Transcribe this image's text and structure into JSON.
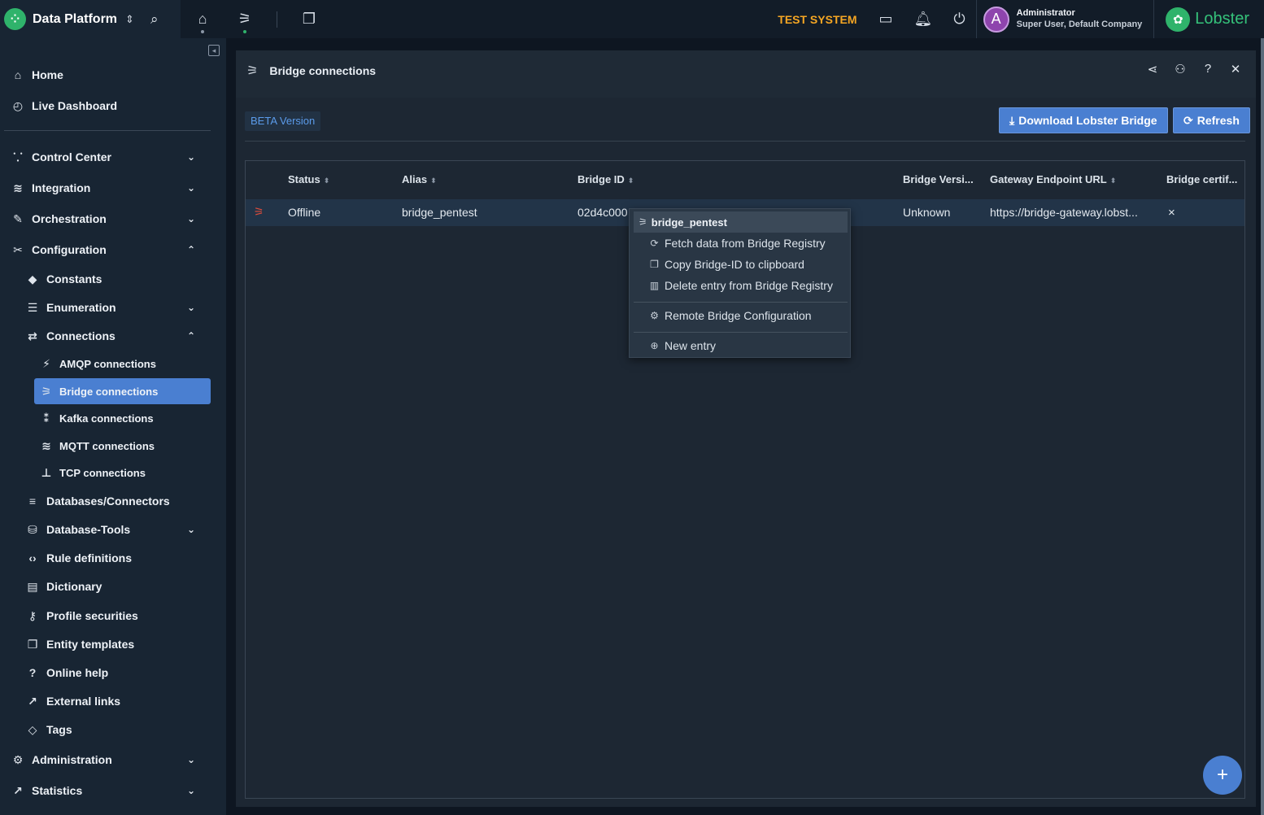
{
  "topbar": {
    "app_title": "Data Platform",
    "test_system": "TEST SYSTEM",
    "user_name": "Administrator",
    "user_role": "Super User, Default Company",
    "avatar_letter": "A",
    "brand_name": "Lobster",
    "icons": [
      "home-icon",
      "bridge-icon",
      "windows-icon",
      "monitor-icon",
      "bell-icon",
      "power-icon"
    ]
  },
  "sidebar": {
    "items": [
      {
        "label": "Home",
        "icon": "home-icon"
      },
      {
        "label": "Live Dashboard",
        "icon": "dashboard-icon"
      },
      {
        "label": "Control Center",
        "icon": "antenna-icon"
      },
      {
        "label": "Integration",
        "icon": "layers-icon"
      },
      {
        "label": "Orchestration",
        "icon": "wand-icon"
      },
      {
        "label": "Configuration",
        "icon": "tools-icon"
      },
      {
        "label": "Constants",
        "icon": "tag-icon"
      },
      {
        "label": "Enumeration",
        "icon": "database-icon"
      },
      {
        "label": "Connections",
        "icon": "arrows-icon"
      },
      {
        "label": "AMQP connections",
        "icon": "bolt-icon"
      },
      {
        "label": "Bridge connections",
        "icon": "bridge-icon"
      },
      {
        "label": "Kafka connections",
        "icon": "kafka-icon"
      },
      {
        "label": "MQTT connections",
        "icon": "rss-icon"
      },
      {
        "label": "TCP connections",
        "icon": "network-icon"
      },
      {
        "label": "Databases/Connectors",
        "icon": "database-icon"
      },
      {
        "label": "Database-Tools",
        "icon": "db-tools-icon"
      },
      {
        "label": "Rule definitions",
        "icon": "code-icon"
      },
      {
        "label": "Dictionary",
        "icon": "book-icon"
      },
      {
        "label": "Profile securities",
        "icon": "key-icon"
      },
      {
        "label": "Entity templates",
        "icon": "copy-icon"
      },
      {
        "label": "Online help",
        "icon": "help-icon"
      },
      {
        "label": "External links",
        "icon": "external-link-icon"
      },
      {
        "label": "Tags",
        "icon": "tags-icon"
      },
      {
        "label": "Administration",
        "icon": "gears-icon"
      },
      {
        "label": "Statistics",
        "icon": "chart-icon"
      }
    ]
  },
  "panel": {
    "title": "Bridge connections",
    "beta_label": "BETA Version",
    "download_label": "Download Lobster Bridge",
    "refresh_label": "Refresh"
  },
  "grid": {
    "columns": [
      "Status",
      "Alias",
      "Bridge ID",
      "Bridge Versi...",
      "Gateway Endpoint URL",
      "Bridge certif..."
    ],
    "rows": [
      {
        "status": "Offline",
        "alias": "bridge_pentest",
        "bridge_id": "02d4c000",
        "version": "Unknown",
        "gateway_url": "https://bridge-gateway.lobst...",
        "cert": "×"
      }
    ]
  },
  "context_menu": {
    "header": "bridge_pentest",
    "items": [
      {
        "label": "Fetch data from Bridge Registry",
        "icon": "refresh-icon"
      },
      {
        "label": "Copy Bridge-ID to clipboard",
        "icon": "copy-icon"
      },
      {
        "label": "Delete entry from Bridge Registry",
        "icon": "trash-icon"
      },
      {
        "label": "Remote Bridge Configuration",
        "icon": "gears-icon"
      },
      {
        "label": "New entry",
        "icon": "plus-circle-icon"
      }
    ]
  },
  "colors": {
    "accent": "#4a7fd1",
    "brand_green": "#2fb36b",
    "warning": "#f5a623",
    "offline": "#e04c3a"
  }
}
